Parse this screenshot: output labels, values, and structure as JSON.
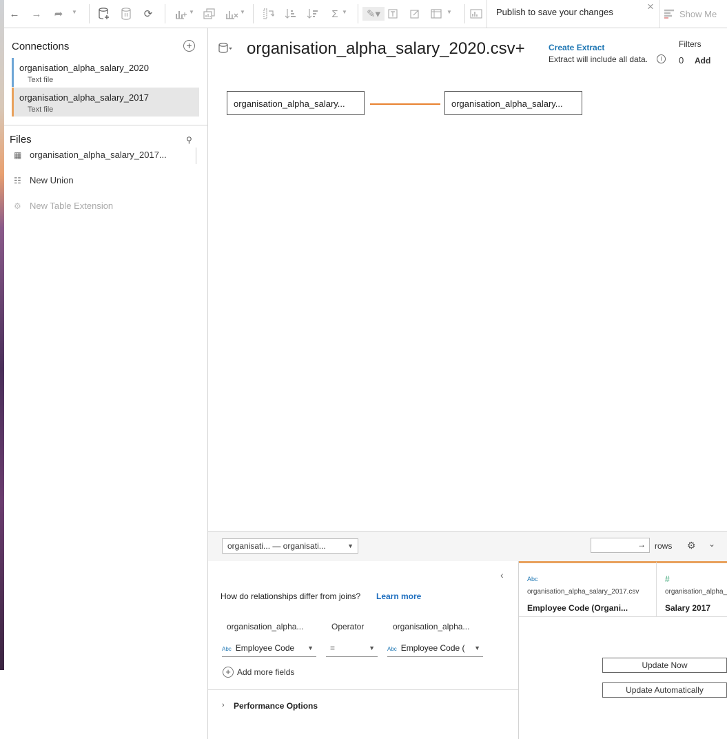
{
  "toolbar": {
    "publish_text": "Publish to save your changes",
    "show_me": "Show Me",
    "icons": [
      "back-icon",
      "forward-icon",
      "redo-icon",
      "new-datasource-icon",
      "pause-updates-icon",
      "refresh-icon",
      "new-worksheet-icon",
      "duplicate-icon",
      "clear-icon",
      "swap-icon",
      "sort-ascending-icon",
      "sort-descending-icon",
      "totals-icon",
      "highlight-icon",
      "labels-icon",
      "annotate-icon",
      "fit-icon",
      "show-me-icon"
    ]
  },
  "sidebar": {
    "connections_title": "Connections",
    "connections": [
      {
        "name": "organisation_alpha_salary_2020",
        "type": "Text file",
        "color": "#6ea6d6"
      },
      {
        "name": "organisation_alpha_salary_2017",
        "type": "Text file",
        "color": "#e8a15c"
      }
    ],
    "files_title": "Files",
    "files": [
      {
        "label": "organisation_alpha_salary_2017...",
        "enabled": true
      },
      {
        "label": "New Union",
        "enabled": true
      },
      {
        "label": "New Table Extension",
        "enabled": false
      }
    ]
  },
  "canvas": {
    "title": "organisation_alpha_salary_2020.csv+",
    "create_extract": "Create Extract",
    "extract_note": "Extract will include all data.",
    "filters_label": "Filters",
    "filters_count": "0",
    "filters_add": "Add",
    "tables": [
      "organisation_alpha_salary...",
      "organisation_alpha_salary..."
    ],
    "relationship_color": "#e8822f"
  },
  "bottom": {
    "relationship_select": "organisati...  — organisati...",
    "rows_label": "rows",
    "question": "How do relationships differ from joins?",
    "learn_more": "Learn more",
    "left_table_header": "organisation_alpha...",
    "operator_header": "Operator",
    "right_table_header": "organisation_alpha...",
    "left_field": "Employee Code",
    "operator": "=",
    "right_field": "Employee Code (",
    "add_more_fields": "Add more fields",
    "performance_options": "Performance Options"
  },
  "grid": {
    "columns": [
      {
        "type": "Abc",
        "source": "organisation_alpha_salary_2017.csv",
        "field": "Employee Code (Organi..."
      },
      {
        "type": "#",
        "source": "organisation_alpha_",
        "field": "Salary 2017"
      }
    ],
    "update_now": "Update Now",
    "update_automatically": "Update Automatically"
  }
}
